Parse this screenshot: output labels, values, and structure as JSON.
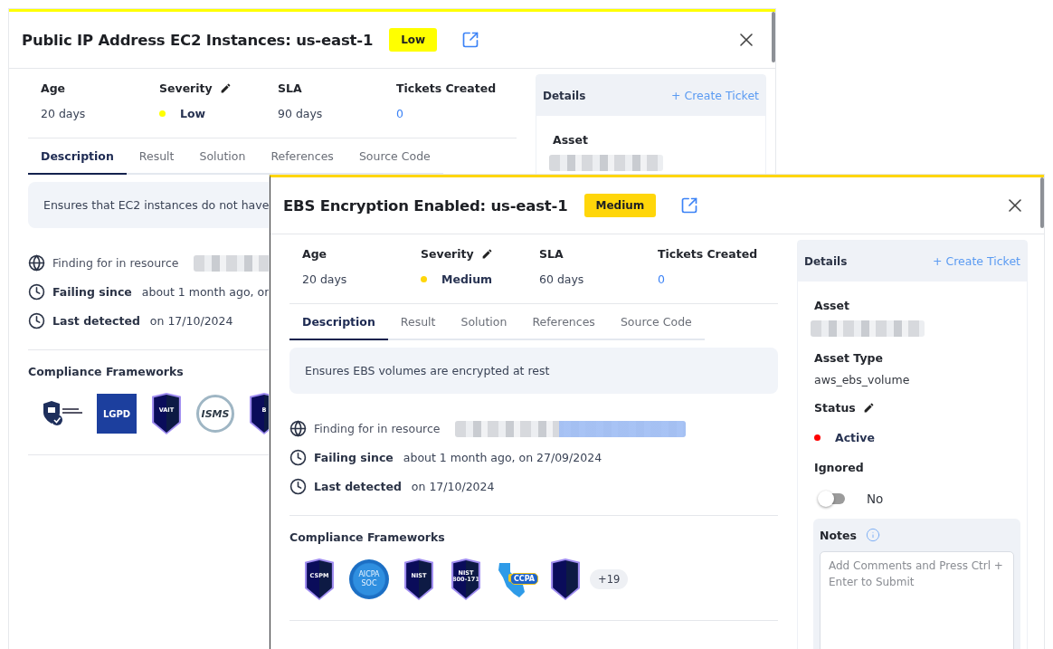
{
  "panels": [
    {
      "title": "Public IP Address EC2 Instances: us-east-1",
      "severity": {
        "label": "Low",
        "color": "#ffff00"
      },
      "stats": [
        {
          "kind": "text",
          "label": "Age",
          "value": "20 days"
        },
        {
          "kind": "severity",
          "label": "Severity",
          "editable": true,
          "value": "Low"
        },
        {
          "kind": "text",
          "label": "SLA",
          "value": "90 days"
        },
        {
          "kind": "link",
          "label": "Tickets Created",
          "value": "0"
        }
      ],
      "tabs": [
        {
          "label": "Description",
          "selected": true
        },
        {
          "label": "Result",
          "selected": false
        },
        {
          "label": "Solution",
          "selected": false
        },
        {
          "label": "References",
          "selected": false
        },
        {
          "label": "Source Code",
          "selected": false
        }
      ],
      "description": "Ensures that EC2 instances do not have",
      "facts": [
        {
          "kind": "resource",
          "label": "Finding for in resource"
        },
        {
          "kind": "time",
          "label": "Failing since",
          "value": "about 1 month ago, on"
        },
        {
          "kind": "time",
          "label": "Last detected",
          "value": "on 17/10/2024"
        }
      ],
      "compliance": {
        "title": "Compliance Frameworks",
        "badges": [
          {
            "kind": "shield-check"
          },
          {
            "kind": "square",
            "label": "LGPD"
          },
          {
            "kind": "shield",
            "label": "VAIT"
          },
          {
            "kind": "emblem",
            "label": "ISMS"
          },
          {
            "kind": "shield",
            "label": "B"
          }
        ]
      },
      "details": {
        "title": "Details",
        "action": "+ Create Ticket",
        "fields": [
          {
            "kind": "redacted",
            "label": "Asset"
          }
        ]
      }
    },
    {
      "title": "EBS Encryption Enabled: us-east-1",
      "severity": {
        "label": "Medium",
        "color": "#ffd60a"
      },
      "stats": [
        {
          "kind": "text",
          "label": "Age",
          "value": "20 days"
        },
        {
          "kind": "severity",
          "label": "Severity",
          "editable": true,
          "value": "Medium"
        },
        {
          "kind": "text",
          "label": "SLA",
          "value": "60 days"
        },
        {
          "kind": "link",
          "label": "Tickets Created",
          "value": "0"
        }
      ],
      "tabs": [
        {
          "label": "Description",
          "selected": true
        },
        {
          "label": "Result",
          "selected": false
        },
        {
          "label": "Solution",
          "selected": false
        },
        {
          "label": "References",
          "selected": false
        },
        {
          "label": "Source Code",
          "selected": false
        }
      ],
      "description": "Ensures EBS volumes are encrypted at rest",
      "facts": [
        {
          "kind": "resource",
          "label": "Finding for in resource"
        },
        {
          "kind": "time",
          "label": "Failing since",
          "value": "about 1 month ago, on 27/09/2024"
        },
        {
          "kind": "time",
          "label": "Last detected",
          "value": "on 17/10/2024"
        }
      ],
      "compliance": {
        "title": "Compliance Frameworks",
        "badges": [
          {
            "kind": "shield",
            "label": "CSPM"
          },
          {
            "kind": "circle",
            "label": "AICPA SOC"
          },
          {
            "kind": "shield",
            "label": "NIST"
          },
          {
            "kind": "shield",
            "label": "NIST 800-171"
          },
          {
            "kind": "map",
            "label": "CCPA"
          },
          {
            "kind": "shield"
          }
        ],
        "more": "+19"
      },
      "details": {
        "title": "Details",
        "action": "+ Create Ticket",
        "fields": [
          {
            "kind": "redacted",
            "label": "Asset"
          },
          {
            "kind": "text",
            "label": "Asset Type",
            "value": "aws_ebs_volume"
          },
          {
            "kind": "status",
            "label": "Status",
            "editable": true,
            "value": "Active",
            "color": "#ff0000"
          },
          {
            "kind": "toggle",
            "label": "Ignored",
            "on": false,
            "value": "No"
          }
        ],
        "notes": {
          "title": "Notes",
          "placeholder": "Add Comments and Press Ctrl + Enter to Submit"
        }
      }
    }
  ]
}
